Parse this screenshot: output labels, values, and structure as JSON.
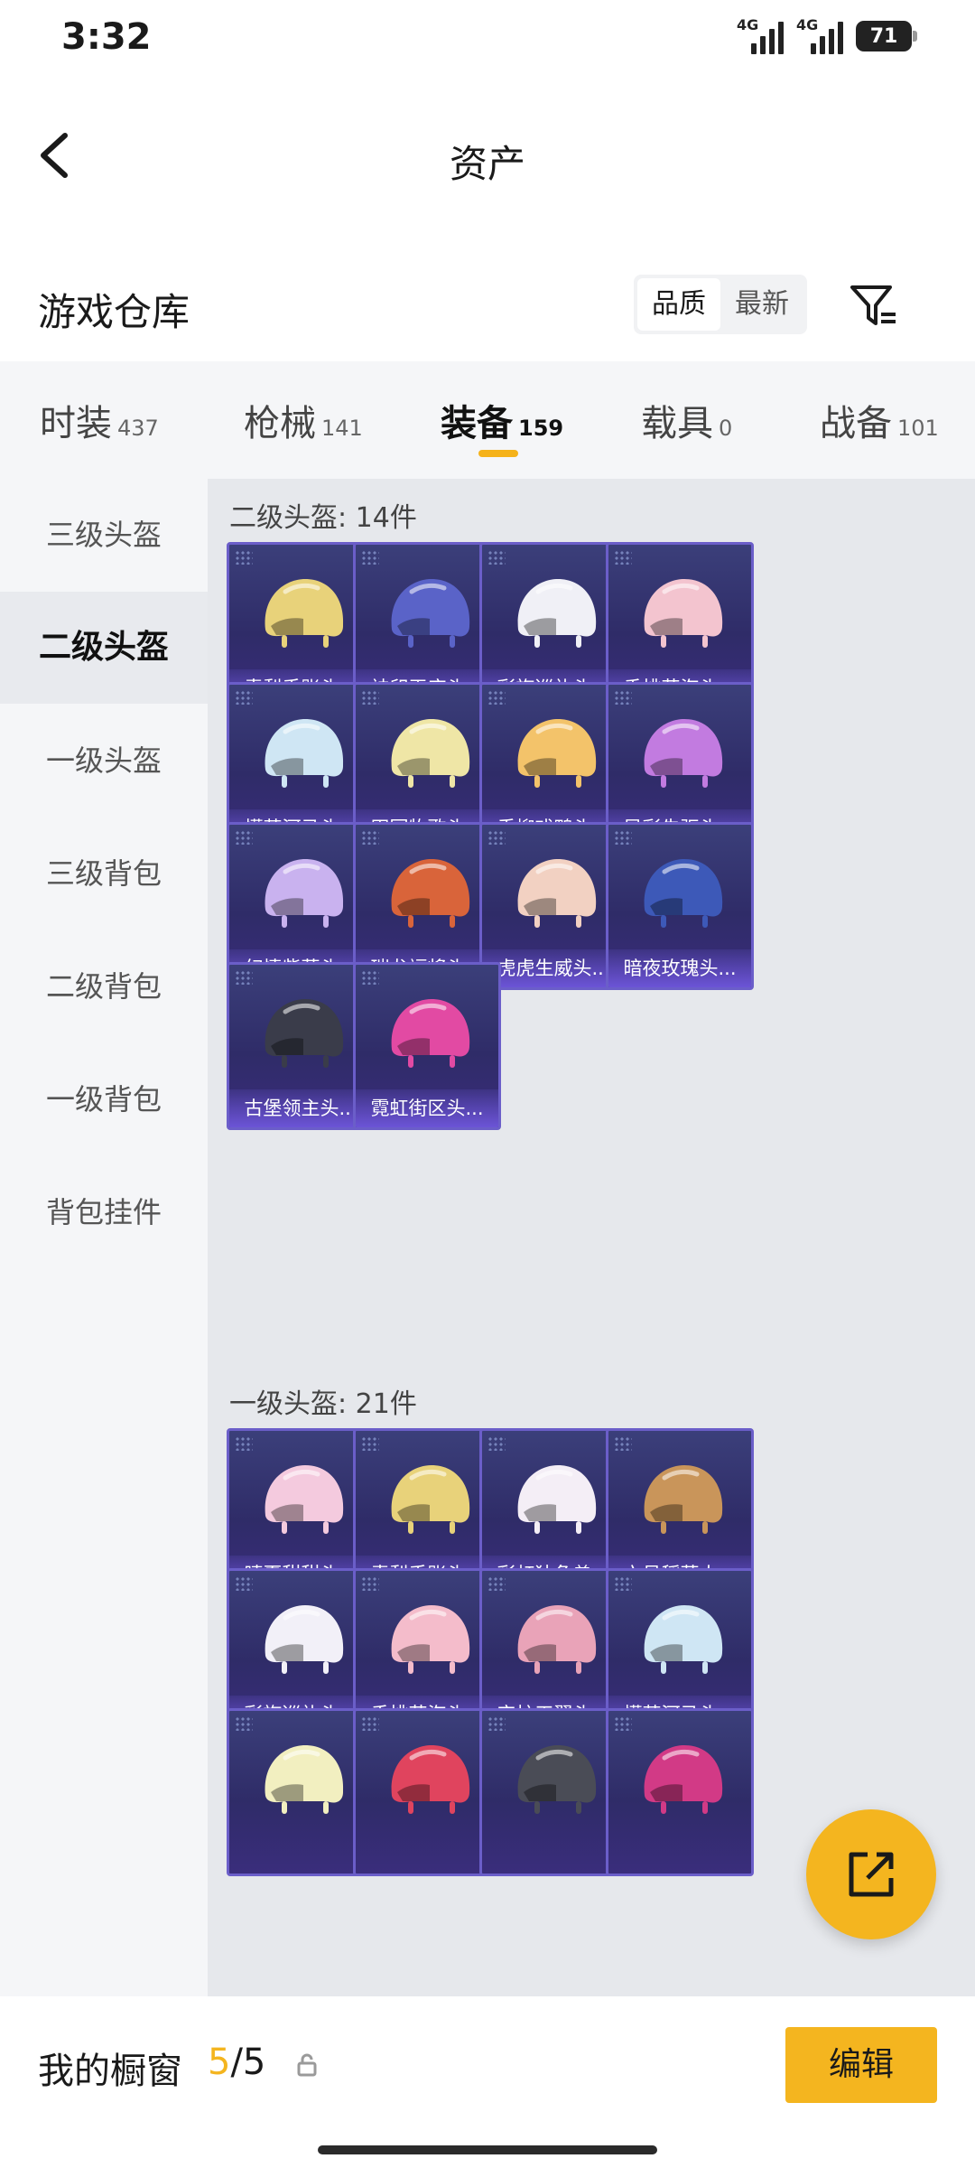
{
  "status": {
    "time": "3:32",
    "net1": "4G",
    "net2": "4G",
    "battery": "71"
  },
  "header": {
    "title": "资产",
    "back_icon": "chevron-left-icon"
  },
  "warehouse": {
    "title": "游戏仓库",
    "sort_options": [
      "品质",
      "最新"
    ],
    "active_sort": "品质",
    "filter_icon": "filter-icon"
  },
  "tabs": [
    {
      "name": "时装",
      "count": "437"
    },
    {
      "name": "枪械",
      "count": "141"
    },
    {
      "name": "装备",
      "count": "159"
    },
    {
      "name": "载具",
      "count": "0"
    },
    {
      "name": "战备",
      "count": "101"
    }
  ],
  "active_tab": "装备",
  "sidebar": {
    "items": [
      "三级头盔",
      "二级头盔",
      "一级头盔",
      "三级背包",
      "二级背包",
      "一级背包",
      "背包挂件"
    ],
    "active": "二级头盔"
  },
  "sections": [
    {
      "title": "二级头盔: 14件",
      "items": [
        {
          "label": "青梨手账头...",
          "color": "#e8d27a"
        },
        {
          "label": "神印王座头...",
          "color": "#5a63c8"
        },
        {
          "label": "彩旗巡礼头...",
          "color": "#f0f0f6"
        },
        {
          "label": "香桃花海头...",
          "color": "#f3c4cf"
        },
        {
          "label": "懵萌河马头...",
          "color": "#cfe6f4"
        },
        {
          "label": "田园牧歌头...",
          "color": "#efe6a6"
        },
        {
          "label": "垂柳戏鸭头...",
          "color": "#f3c36a"
        },
        {
          "label": "异彩先驱头...",
          "color": "#c27be0"
        },
        {
          "label": "幻情紫藤头...",
          "color": "#c9b2ef"
        },
        {
          "label": "瑞龙福将头...",
          "color": "#d9643a"
        },
        {
          "label": "虎虎生威头...",
          "color": "#f2d1c2"
        },
        {
          "label": "暗夜玫瑰头...",
          "color": "#3d59b8"
        },
        {
          "label": "古堡领主头...",
          "color": "#3a3c4a"
        },
        {
          "label": "霓虹街区头...",
          "color": "#e24aa3"
        }
      ]
    },
    {
      "title": "一级头盔: 21件",
      "items": [
        {
          "label": "晴夏甜甜头...",
          "color": "#f4cade"
        },
        {
          "label": "青梨手账头...",
          "color": "#e8d27a"
        },
        {
          "label": "彩虹独角兽...",
          "color": "#f4eef6"
        },
        {
          "label": "六号稻草人...",
          "color": "#c9955a"
        },
        {
          "label": "彩旗巡礼头...",
          "color": "#f2f0f8"
        },
        {
          "label": "香桃花海头...",
          "color": "#f4bccb"
        },
        {
          "label": "守护天翼头...",
          "color": "#e9a3b8"
        },
        {
          "label": "懵萌河马头...",
          "color": "#cfe6f4"
        },
        {
          "label": "",
          "color": "#f2efc0"
        },
        {
          "label": "",
          "color": "#e0445e"
        },
        {
          "label": "",
          "color": "#4a4c56"
        },
        {
          "label": "",
          "color": "#d23a86"
        }
      ]
    }
  ],
  "bottom": {
    "label": "我的橱窗",
    "current": "5",
    "total": "/5",
    "edit_label": "编辑",
    "lock_icon": "lock-icon"
  },
  "fab_icon": "share-icon",
  "accent_color": "#f4b51f"
}
